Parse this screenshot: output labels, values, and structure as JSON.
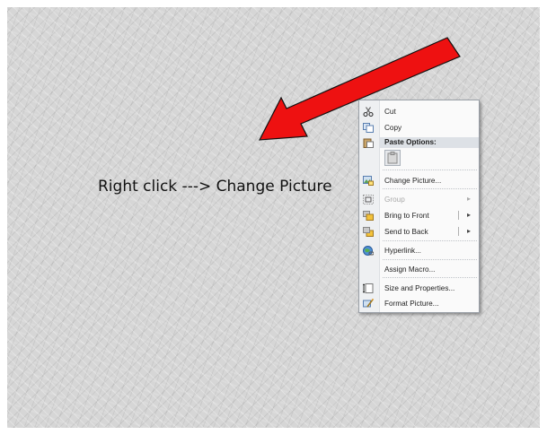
{
  "slide": {
    "instruction": "Right click ---> Change Picture"
  },
  "colors": {
    "arrow": "#ee1111",
    "menu_background": "#fafafa",
    "menu_header": "#dde1e6"
  },
  "context_menu": {
    "cut": "Cut",
    "copy": "Copy",
    "paste_options": "Paste Options:",
    "change_picture": "Change Picture...",
    "group": "Group",
    "bring_to_front": "Bring to Front",
    "send_to_back": "Send to Back",
    "hyperlink": "Hyperlink...",
    "assign_macro": "Assign Macro...",
    "size_and_properties": "Size and Properties...",
    "format_picture": "Format Picture...",
    "icons": {
      "cut": "scissors-icon",
      "copy": "copy-icon",
      "paste_options": "clipboard-icon",
      "change_picture": "change-picture-icon",
      "group": "group-icon",
      "bring_to_front": "bring-to-front-icon",
      "send_to_back": "send-to-back-icon",
      "hyperlink": "globe-link-icon",
      "size_and_properties": "size-properties-icon",
      "format_picture": "format-picture-icon"
    }
  }
}
